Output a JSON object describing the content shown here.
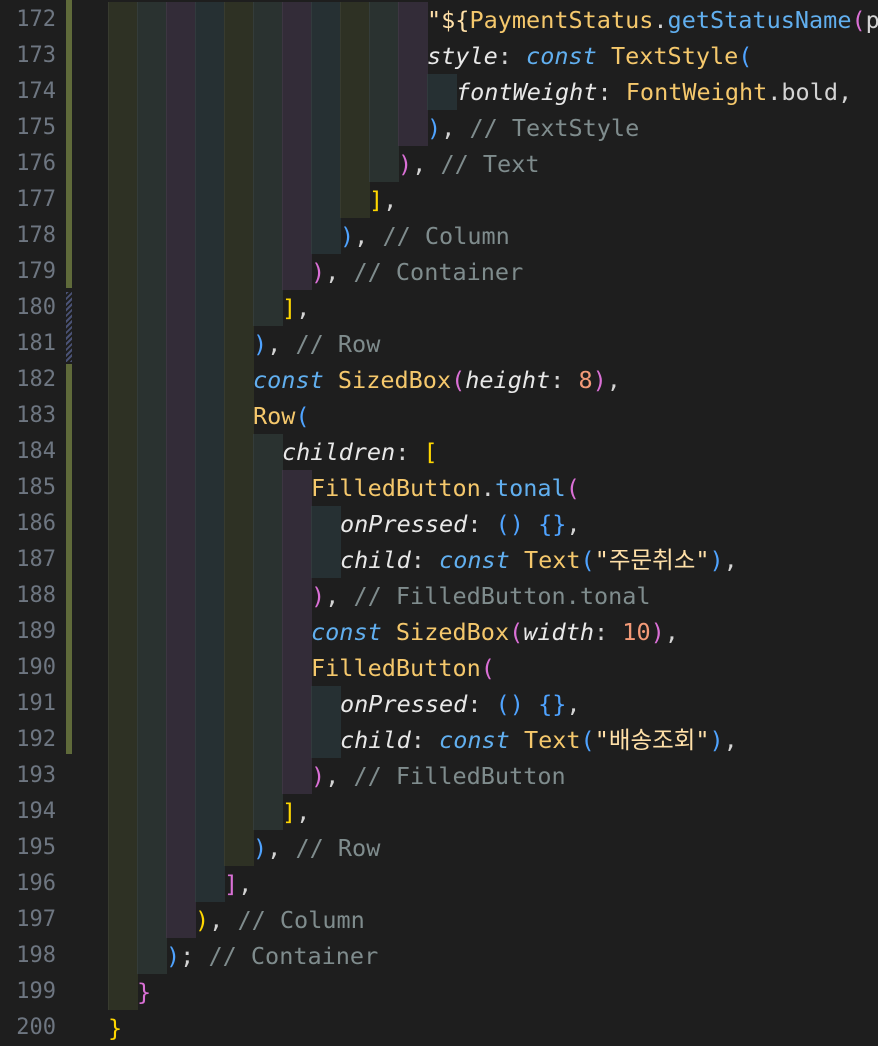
{
  "editor": {
    "language": "dart",
    "lines": [
      {
        "num": "172",
        "indent": 11,
        "tokens": [
          {
            "t": "\"${",
            "c": "str"
          },
          {
            "t": "PaymentStatus",
            "c": "cls"
          },
          {
            "t": ".",
            "c": "p"
          },
          {
            "t": "getStatusName",
            "c": "fn"
          },
          {
            "t": "(",
            "c": "br-m"
          },
          {
            "t": "p",
            "c": "p"
          }
        ]
      },
      {
        "num": "173",
        "indent": 11,
        "tokens": [
          {
            "t": "style",
            "c": "prop"
          },
          {
            "t": ": ",
            "c": "p"
          },
          {
            "t": "const",
            "c": "kw"
          },
          {
            "t": " ",
            "c": "p"
          },
          {
            "t": "TextStyle",
            "c": "cls"
          },
          {
            "t": "(",
            "c": "br-b"
          }
        ]
      },
      {
        "num": "174",
        "indent": 12,
        "tokens": [
          {
            "t": "fontWeight",
            "c": "prop"
          },
          {
            "t": ": ",
            "c": "p"
          },
          {
            "t": "FontWeight",
            "c": "cls"
          },
          {
            "t": ".bold,",
            "c": "p"
          }
        ]
      },
      {
        "num": "175",
        "indent": 11,
        "tokens": [
          {
            "t": ")",
            "c": "br-b"
          },
          {
            "t": ", ",
            "c": "p"
          },
          {
            "t": "// TextStyle",
            "c": "cmt"
          }
        ]
      },
      {
        "num": "176",
        "indent": 10,
        "tokens": [
          {
            "t": ")",
            "c": "br-m"
          },
          {
            "t": ", ",
            "c": "p"
          },
          {
            "t": "// Text",
            "c": "cmt"
          }
        ]
      },
      {
        "num": "177",
        "indent": 9,
        "tokens": [
          {
            "t": "]",
            "c": "br-y"
          },
          {
            "t": ",",
            "c": "p"
          }
        ]
      },
      {
        "num": "178",
        "indent": 8,
        "tokens": [
          {
            "t": ")",
            "c": "br-b"
          },
          {
            "t": ", ",
            "c": "p"
          },
          {
            "t": "// Column",
            "c": "cmt"
          }
        ]
      },
      {
        "num": "179",
        "indent": 7,
        "tokens": [
          {
            "t": ")",
            "c": "br-m"
          },
          {
            "t": ", ",
            "c": "p"
          },
          {
            "t": "// Container",
            "c": "cmt"
          }
        ]
      },
      {
        "num": "180",
        "indent": 6,
        "tokens": [
          {
            "t": "]",
            "c": "br-y"
          },
          {
            "t": ",",
            "c": "p"
          }
        ]
      },
      {
        "num": "181",
        "indent": 5,
        "tokens": [
          {
            "t": ")",
            "c": "br-b"
          },
          {
            "t": ", ",
            "c": "p"
          },
          {
            "t": "// Row",
            "c": "cmt"
          }
        ]
      },
      {
        "num": "182",
        "indent": 5,
        "tokens": [
          {
            "t": "const",
            "c": "kw"
          },
          {
            "t": " ",
            "c": "p"
          },
          {
            "t": "SizedBox",
            "c": "cls"
          },
          {
            "t": "(",
            "c": "br-m"
          },
          {
            "t": "height",
            "c": "prop"
          },
          {
            "t": ": ",
            "c": "p"
          },
          {
            "t": "8",
            "c": "num"
          },
          {
            "t": ")",
            "c": "br-m"
          },
          {
            "t": ",",
            "c": "p"
          }
        ]
      },
      {
        "num": "183",
        "indent": 5,
        "tokens": [
          {
            "t": "Row",
            "c": "cls"
          },
          {
            "t": "(",
            "c": "br-b"
          }
        ]
      },
      {
        "num": "184",
        "indent": 6,
        "tokens": [
          {
            "t": "children",
            "c": "prop"
          },
          {
            "t": ": ",
            "c": "p"
          },
          {
            "t": "[",
            "c": "br-y"
          }
        ]
      },
      {
        "num": "185",
        "indent": 7,
        "tokens": [
          {
            "t": "FilledButton",
            "c": "cls"
          },
          {
            "t": ".",
            "c": "p"
          },
          {
            "t": "tonal",
            "c": "fn"
          },
          {
            "t": "(",
            "c": "br-m"
          }
        ]
      },
      {
        "num": "186",
        "indent": 8,
        "tokens": [
          {
            "t": "onPressed",
            "c": "prop"
          },
          {
            "t": ": ",
            "c": "p"
          },
          {
            "t": "()",
            "c": "br-b"
          },
          {
            "t": " ",
            "c": "p"
          },
          {
            "t": "{}",
            "c": "br-b"
          },
          {
            "t": ",",
            "c": "p"
          }
        ]
      },
      {
        "num": "187",
        "indent": 8,
        "tokens": [
          {
            "t": "child",
            "c": "prop"
          },
          {
            "t": ": ",
            "c": "p"
          },
          {
            "t": "const",
            "c": "kw"
          },
          {
            "t": " ",
            "c": "p"
          },
          {
            "t": "Text",
            "c": "cls"
          },
          {
            "t": "(",
            "c": "br-b"
          },
          {
            "t": "\"주문취소\"",
            "c": "str"
          },
          {
            "t": ")",
            "c": "br-b"
          },
          {
            "t": ",",
            "c": "p"
          }
        ]
      },
      {
        "num": "188",
        "indent": 7,
        "tokens": [
          {
            "t": ")",
            "c": "br-m"
          },
          {
            "t": ", ",
            "c": "p"
          },
          {
            "t": "// FilledButton.tonal",
            "c": "cmt"
          }
        ]
      },
      {
        "num": "189",
        "indent": 7,
        "tokens": [
          {
            "t": "const",
            "c": "kw"
          },
          {
            "t": " ",
            "c": "p"
          },
          {
            "t": "SizedBox",
            "c": "cls"
          },
          {
            "t": "(",
            "c": "br-m"
          },
          {
            "t": "width",
            "c": "prop"
          },
          {
            "t": ": ",
            "c": "p"
          },
          {
            "t": "10",
            "c": "num"
          },
          {
            "t": ")",
            "c": "br-m"
          },
          {
            "t": ",",
            "c": "p"
          }
        ]
      },
      {
        "num": "190",
        "indent": 7,
        "tokens": [
          {
            "t": "FilledButton",
            "c": "cls"
          },
          {
            "t": "(",
            "c": "br-m"
          }
        ]
      },
      {
        "num": "191",
        "indent": 8,
        "tokens": [
          {
            "t": "onPressed",
            "c": "prop"
          },
          {
            "t": ": ",
            "c": "p"
          },
          {
            "t": "()",
            "c": "br-b"
          },
          {
            "t": " ",
            "c": "p"
          },
          {
            "t": "{}",
            "c": "br-b"
          },
          {
            "t": ",",
            "c": "p"
          }
        ]
      },
      {
        "num": "192",
        "indent": 8,
        "tokens": [
          {
            "t": "child",
            "c": "prop"
          },
          {
            "t": ": ",
            "c": "p"
          },
          {
            "t": "const",
            "c": "kw"
          },
          {
            "t": " ",
            "c": "p"
          },
          {
            "t": "Text",
            "c": "cls"
          },
          {
            "t": "(",
            "c": "br-b"
          },
          {
            "t": "\"배송조회\"",
            "c": "str"
          },
          {
            "t": ")",
            "c": "br-b"
          },
          {
            "t": ",",
            "c": "p"
          }
        ]
      },
      {
        "num": "193",
        "indent": 7,
        "tokens": [
          {
            "t": ")",
            "c": "br-m"
          },
          {
            "t": ", ",
            "c": "p"
          },
          {
            "t": "// FilledButton",
            "c": "cmt"
          }
        ]
      },
      {
        "num": "194",
        "indent": 6,
        "tokens": [
          {
            "t": "]",
            "c": "br-y"
          },
          {
            "t": ",",
            "c": "p"
          }
        ]
      },
      {
        "num": "195",
        "indent": 5,
        "tokens": [
          {
            "t": ")",
            "c": "br-b"
          },
          {
            "t": ", ",
            "c": "p"
          },
          {
            "t": "// Row",
            "c": "cmt"
          }
        ]
      },
      {
        "num": "196",
        "indent": 4,
        "tokens": [
          {
            "t": "]",
            "c": "br-m"
          },
          {
            "t": ",",
            "c": "p"
          }
        ]
      },
      {
        "num": "197",
        "indent": 3,
        "tokens": [
          {
            "t": ")",
            "c": "br-y"
          },
          {
            "t": ", ",
            "c": "p"
          },
          {
            "t": "// Column",
            "c": "cmt"
          }
        ]
      },
      {
        "num": "198",
        "indent": 2,
        "tokens": [
          {
            "t": ")",
            "c": "br-b"
          },
          {
            "t": "; ",
            "c": "p"
          },
          {
            "t": "// Container",
            "c": "cmt"
          }
        ]
      },
      {
        "num": "199",
        "indent": 1,
        "tokens": [
          {
            "t": "}",
            "c": "br-m"
          }
        ]
      },
      {
        "num": "200",
        "indent": 0,
        "tokens": [
          {
            "t": "}",
            "c": "br-y"
          }
        ]
      }
    ]
  },
  "colors": {
    "background": "#1e1e1e",
    "git_modified": "#5f6a3a",
    "indent_guides": [
      "#2e3124",
      "#2a3230",
      "#332c38",
      "#263033"
    ]
  }
}
